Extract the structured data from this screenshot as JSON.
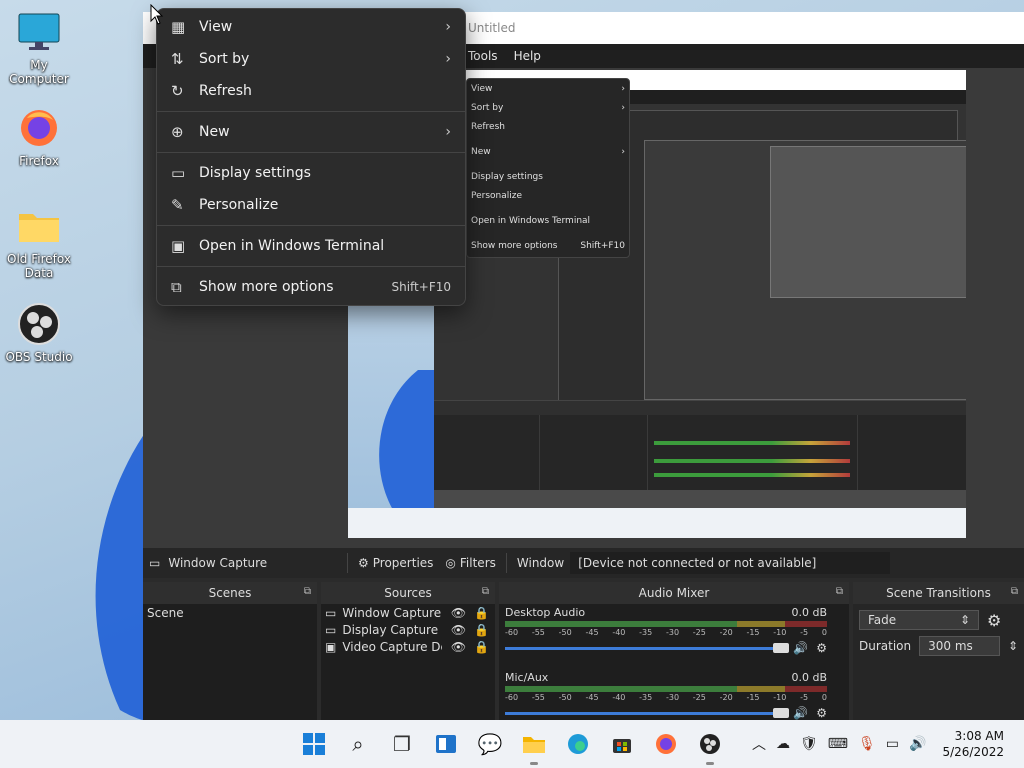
{
  "desktop": {
    "icons": [
      {
        "label": "My Computer",
        "icon": "monitor-icon"
      },
      {
        "label": "Firefox",
        "icon": "firefox-icon"
      },
      {
        "label": "Old Firefox Data",
        "icon": "folder-icon"
      },
      {
        "label": "OBS Studio",
        "icon": "obs-icon"
      }
    ]
  },
  "obs": {
    "title": "Untitled",
    "menu": [
      "Tools",
      "Help"
    ],
    "toolbar": {
      "capture_label": "Window Capture",
      "properties": "Properties",
      "filters": "Filters",
      "window_label": "Window",
      "window_value": "[Device not connected or not available]"
    },
    "scenes": {
      "header": "Scenes",
      "items": [
        "Scene"
      ]
    },
    "sources": {
      "header": "Sources",
      "items": [
        "Window Capture",
        "Display Capture",
        "Video Capture Device"
      ]
    },
    "mixer": {
      "header": "Audio Mixer",
      "channels": [
        {
          "name": "Desktop Audio",
          "level": "0.0 dB"
        },
        {
          "name": "Mic/Aux",
          "level": "0.0 dB"
        }
      ],
      "scale": [
        "-60",
        "-55",
        "-50",
        "-45",
        "-40",
        "-35",
        "-30",
        "-25",
        "-20",
        "-15",
        "-10",
        "-5",
        "0"
      ]
    },
    "transitions": {
      "header": "Scene Transitions",
      "selected": "Fade",
      "duration_label": "Duration",
      "duration_value": "300 ms"
    }
  },
  "context_menu": {
    "items": [
      {
        "label": "View",
        "icon": "grid-icon",
        "submenu": true
      },
      {
        "label": "Sort by",
        "icon": "sort-icon",
        "submenu": true
      },
      {
        "label": "Refresh",
        "icon": "refresh-icon"
      },
      {
        "label": "New",
        "icon": "plus-circle-icon",
        "submenu": true
      },
      {
        "label": "Display settings",
        "icon": "display-icon"
      },
      {
        "label": "Personalize",
        "icon": "brush-icon"
      },
      {
        "label": "Open in Windows Terminal",
        "icon": "terminal-icon"
      },
      {
        "label": "Show more options",
        "icon": "more-options-icon",
        "shortcut": "Shift+F10"
      }
    ]
  },
  "taskbar": {
    "clock_time": "3:08 AM",
    "clock_date": "5/26/2022"
  }
}
